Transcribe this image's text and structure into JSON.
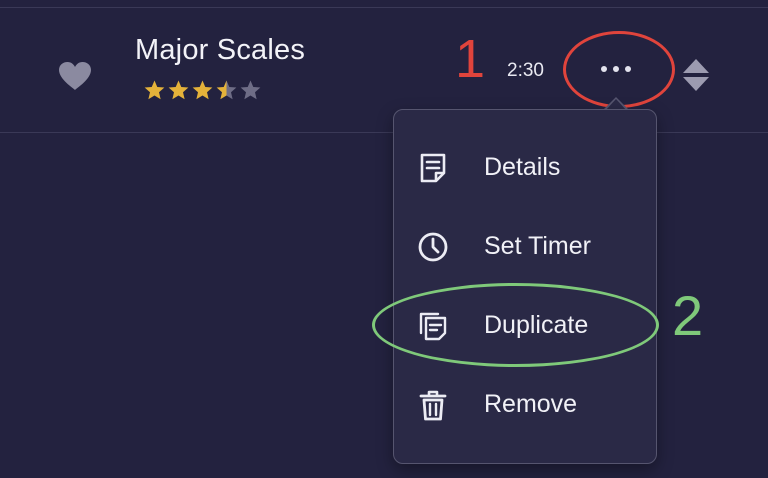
{
  "item": {
    "title": "Major Scales",
    "rating": 3.5,
    "rating_max": 5,
    "duration": "2:30",
    "favorite_icon": "heart-icon",
    "more_icon": "ellipsis-icon",
    "reorder_icon": "reorder-icon"
  },
  "menu": {
    "items": [
      {
        "label": "Details",
        "icon": "note-icon"
      },
      {
        "label": "Set Timer",
        "icon": "clock-icon"
      },
      {
        "label": "Duplicate",
        "icon": "duplicate-icon"
      },
      {
        "label": "Remove",
        "icon": "trash-icon"
      }
    ]
  },
  "annotations": {
    "step1": "1",
    "step2": "2"
  },
  "colors": {
    "background": "#23223f",
    "menu_background": "#2a2946",
    "star_filled": "#e4b23a",
    "star_empty": "#6e6d86",
    "annotation_red": "#e0443c",
    "annotation_green": "#7fc97a"
  }
}
